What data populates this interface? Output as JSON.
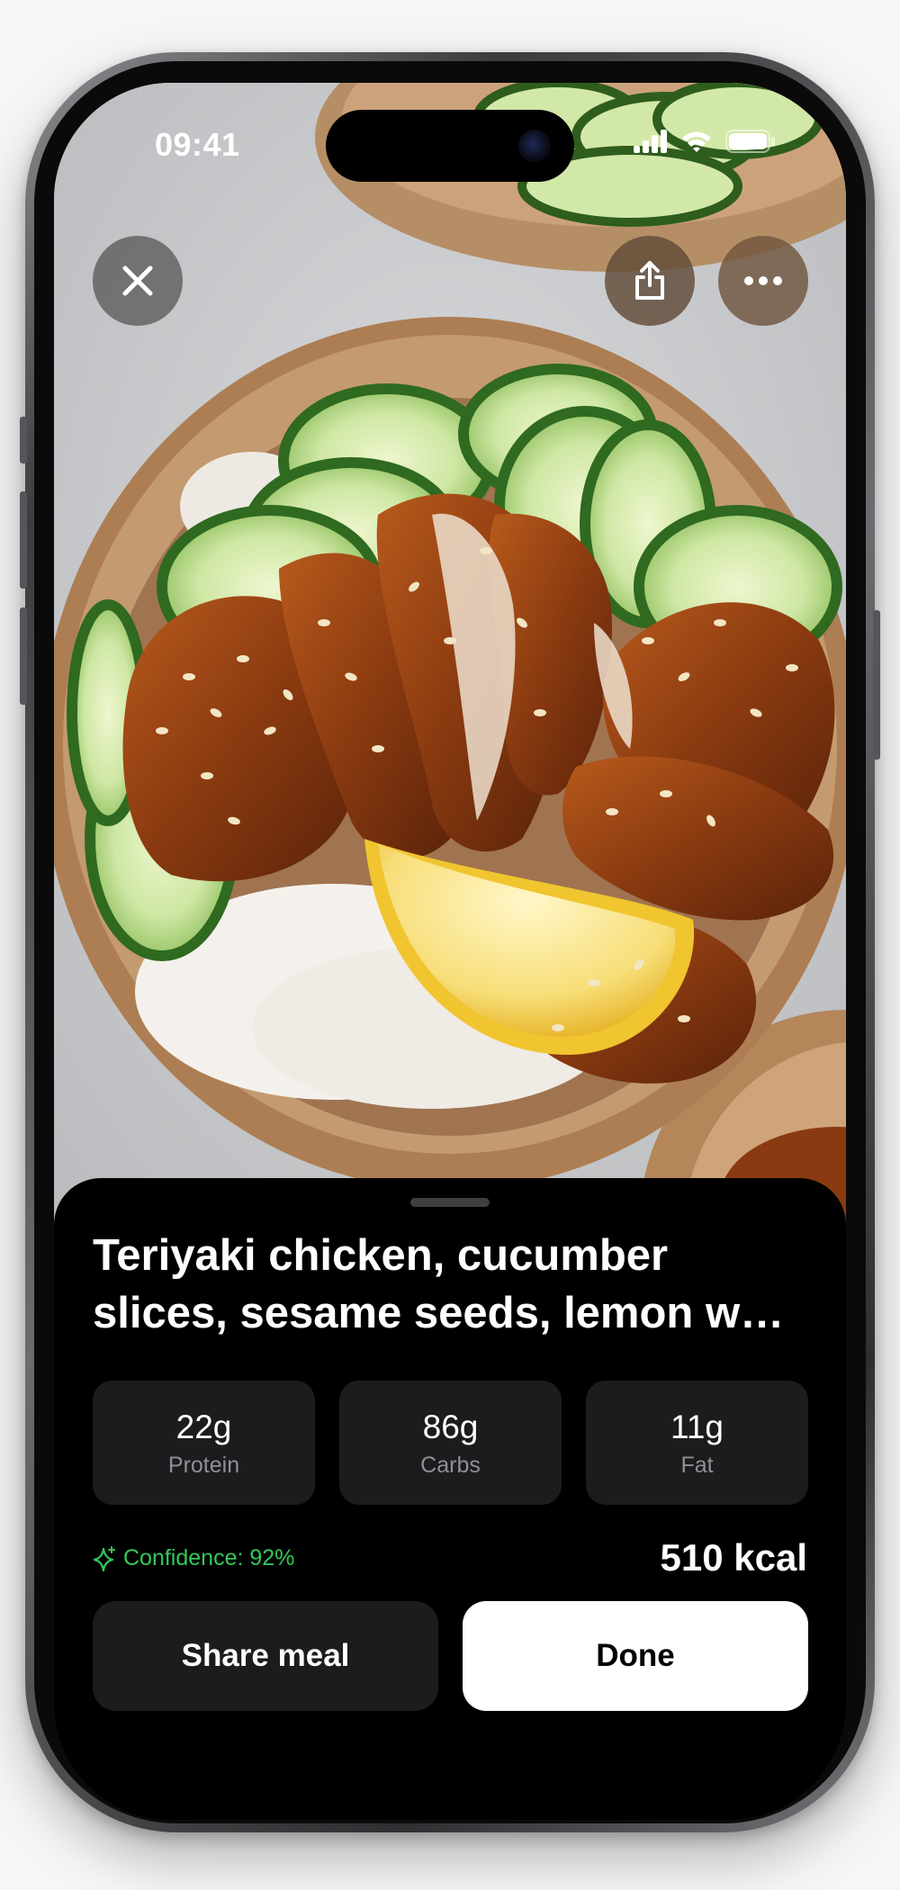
{
  "status_bar": {
    "time": "09:41"
  },
  "meal": {
    "title": "Teriyaki chicken, cucumber slices, sesame seeds, lemon w…",
    "macros": [
      {
        "value": "22g",
        "label": "Protein"
      },
      {
        "value": "86g",
        "label": "Carbs"
      },
      {
        "value": "11g",
        "label": "Fat"
      }
    ],
    "confidence": "Confidence: 92%",
    "calories": "510 kcal"
  },
  "actions": {
    "share_label": "Share meal",
    "done_label": "Done"
  },
  "colors": {
    "sheet_background": "#000000",
    "card_background": "#1c1c1e",
    "confidence_green": "#35c759",
    "primary_button": "#ffffff"
  },
  "icons": [
    "close-icon",
    "share-icon",
    "more-icon",
    "sparkle-icon",
    "signal-icon",
    "wifi-icon",
    "battery-icon"
  ]
}
